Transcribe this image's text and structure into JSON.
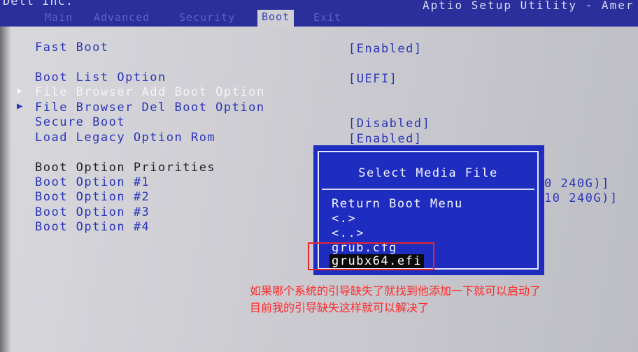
{
  "header": {
    "vendor": "Dell Inc.",
    "utility_title": "Aptio Setup Utility - Amer",
    "tabs": [
      {
        "label": "Main",
        "active": false
      },
      {
        "label": "Advanced",
        "active": false
      },
      {
        "label": "Security",
        "active": false
      },
      {
        "label": "Boot",
        "active": true
      },
      {
        "label": "Exit",
        "active": false
      }
    ]
  },
  "setup": {
    "fast_boot": {
      "label": "Fast Boot",
      "value": "[Enabled]"
    },
    "boot_list_option": {
      "label": "Boot List Option",
      "value": "[UEFI]"
    },
    "file_browser_add": {
      "label": "File Browser Add Boot Option"
    },
    "file_browser_del": {
      "label": "File Browser Del Boot Option"
    },
    "secure_boot": {
      "label": "Secure Boot",
      "value": "[Disabled]"
    },
    "legacy_rom": {
      "label": "Load Legacy Option Rom",
      "value": "[Enabled]"
    },
    "priorities_heading": "Boot Option Priorities",
    "boot_options": [
      {
        "label": "Boot Option #1",
        "value_tail": "0 240G)]"
      },
      {
        "label": "Boot Option #2",
        "value_tail": "10 240G)]"
      },
      {
        "label": "Boot Option #3"
      },
      {
        "label": "Boot Option #4"
      }
    ]
  },
  "dialog": {
    "title": "Select Media File",
    "items": [
      {
        "label": "Return Boot Menu",
        "selected": false
      },
      {
        "label": "<.>",
        "selected": false
      },
      {
        "label": "<..>",
        "selected": false
      },
      {
        "label": "grub.cfg",
        "selected": false
      },
      {
        "label": "grubx64.efi",
        "selected": true
      }
    ]
  },
  "annotation": {
    "line1": "如果哪个系统的引导缺失了就找到他添加一下就可以启动了",
    "line2": "目前我的引导缺失这样就可以解决了",
    "color": "#ff2a2a"
  },
  "colors": {
    "bios_blue": "#2c36b8",
    "dialog_blue": "#1f2cc0",
    "highlight_red": "#e8262a"
  }
}
